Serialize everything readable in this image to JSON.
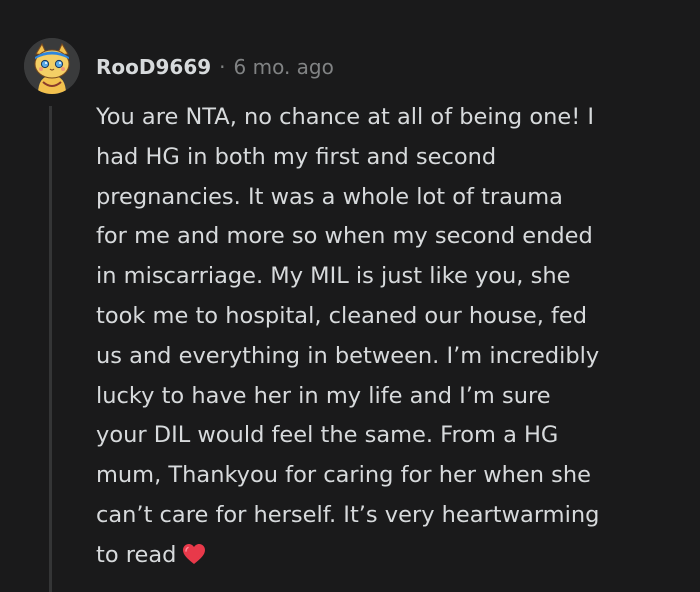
{
  "comment": {
    "author": "RooD9669",
    "separator": "·",
    "timestamp": "6 mo. ago",
    "avatar_icon": "cat-avatar-icon",
    "lines": [
      "You are NTA, no chance at all of being one! I",
      "had HG in both my first and second",
      "pregnancies. It was a whole lot of trauma",
      "for me and more so when my second ended",
      "in miscarriage. My MIL is just like you, she",
      "took me to hospital, cleaned our house, fed",
      "us and everything in between. I’m incredibly",
      "lucky to have her in my life and I’m sure",
      "your DIL would feel the same. From a HG",
      "mum, Thankyou for caring for her when she",
      "can’t care for herself. It’s very heartwarming",
      "to read"
    ],
    "emoji_icon": "red-heart-icon"
  },
  "colors": {
    "background": "#1a1a1b",
    "text": "#d7dadc",
    "muted": "#818384",
    "thread_line": "#343536",
    "heart": "#e8394a"
  }
}
